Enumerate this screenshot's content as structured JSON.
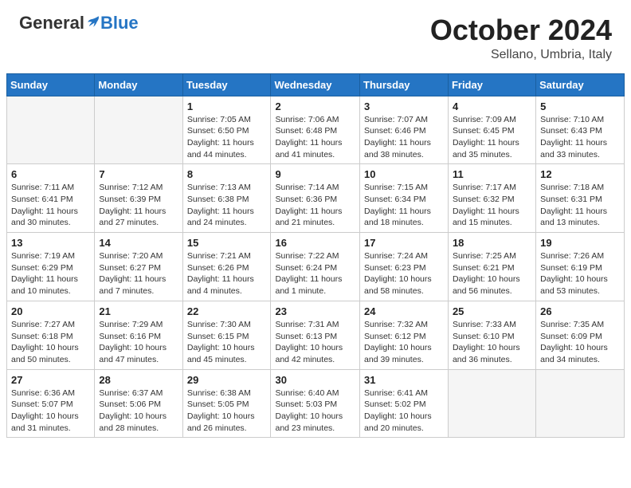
{
  "header": {
    "logo_general": "General",
    "logo_blue": "Blue",
    "month": "October 2024",
    "location": "Sellano, Umbria, Italy"
  },
  "days_of_week": [
    "Sunday",
    "Monday",
    "Tuesday",
    "Wednesday",
    "Thursday",
    "Friday",
    "Saturday"
  ],
  "weeks": [
    [
      {
        "day": "",
        "sunrise": "",
        "sunset": "",
        "daylight": ""
      },
      {
        "day": "",
        "sunrise": "",
        "sunset": "",
        "daylight": ""
      },
      {
        "day": "1",
        "sunrise": "Sunrise: 7:05 AM",
        "sunset": "Sunset: 6:50 PM",
        "daylight": "Daylight: 11 hours and 44 minutes."
      },
      {
        "day": "2",
        "sunrise": "Sunrise: 7:06 AM",
        "sunset": "Sunset: 6:48 PM",
        "daylight": "Daylight: 11 hours and 41 minutes."
      },
      {
        "day": "3",
        "sunrise": "Sunrise: 7:07 AM",
        "sunset": "Sunset: 6:46 PM",
        "daylight": "Daylight: 11 hours and 38 minutes."
      },
      {
        "day": "4",
        "sunrise": "Sunrise: 7:09 AM",
        "sunset": "Sunset: 6:45 PM",
        "daylight": "Daylight: 11 hours and 35 minutes."
      },
      {
        "day": "5",
        "sunrise": "Sunrise: 7:10 AM",
        "sunset": "Sunset: 6:43 PM",
        "daylight": "Daylight: 11 hours and 33 minutes."
      }
    ],
    [
      {
        "day": "6",
        "sunrise": "Sunrise: 7:11 AM",
        "sunset": "Sunset: 6:41 PM",
        "daylight": "Daylight: 11 hours and 30 minutes."
      },
      {
        "day": "7",
        "sunrise": "Sunrise: 7:12 AM",
        "sunset": "Sunset: 6:39 PM",
        "daylight": "Daylight: 11 hours and 27 minutes."
      },
      {
        "day": "8",
        "sunrise": "Sunrise: 7:13 AM",
        "sunset": "Sunset: 6:38 PM",
        "daylight": "Daylight: 11 hours and 24 minutes."
      },
      {
        "day": "9",
        "sunrise": "Sunrise: 7:14 AM",
        "sunset": "Sunset: 6:36 PM",
        "daylight": "Daylight: 11 hours and 21 minutes."
      },
      {
        "day": "10",
        "sunrise": "Sunrise: 7:15 AM",
        "sunset": "Sunset: 6:34 PM",
        "daylight": "Daylight: 11 hours and 18 minutes."
      },
      {
        "day": "11",
        "sunrise": "Sunrise: 7:17 AM",
        "sunset": "Sunset: 6:32 PM",
        "daylight": "Daylight: 11 hours and 15 minutes."
      },
      {
        "day": "12",
        "sunrise": "Sunrise: 7:18 AM",
        "sunset": "Sunset: 6:31 PM",
        "daylight": "Daylight: 11 hours and 13 minutes."
      }
    ],
    [
      {
        "day": "13",
        "sunrise": "Sunrise: 7:19 AM",
        "sunset": "Sunset: 6:29 PM",
        "daylight": "Daylight: 11 hours and 10 minutes."
      },
      {
        "day": "14",
        "sunrise": "Sunrise: 7:20 AM",
        "sunset": "Sunset: 6:27 PM",
        "daylight": "Daylight: 11 hours and 7 minutes."
      },
      {
        "day": "15",
        "sunrise": "Sunrise: 7:21 AM",
        "sunset": "Sunset: 6:26 PM",
        "daylight": "Daylight: 11 hours and 4 minutes."
      },
      {
        "day": "16",
        "sunrise": "Sunrise: 7:22 AM",
        "sunset": "Sunset: 6:24 PM",
        "daylight": "Daylight: 11 hours and 1 minute."
      },
      {
        "day": "17",
        "sunrise": "Sunrise: 7:24 AM",
        "sunset": "Sunset: 6:23 PM",
        "daylight": "Daylight: 10 hours and 58 minutes."
      },
      {
        "day": "18",
        "sunrise": "Sunrise: 7:25 AM",
        "sunset": "Sunset: 6:21 PM",
        "daylight": "Daylight: 10 hours and 56 minutes."
      },
      {
        "day": "19",
        "sunrise": "Sunrise: 7:26 AM",
        "sunset": "Sunset: 6:19 PM",
        "daylight": "Daylight: 10 hours and 53 minutes."
      }
    ],
    [
      {
        "day": "20",
        "sunrise": "Sunrise: 7:27 AM",
        "sunset": "Sunset: 6:18 PM",
        "daylight": "Daylight: 10 hours and 50 minutes."
      },
      {
        "day": "21",
        "sunrise": "Sunrise: 7:29 AM",
        "sunset": "Sunset: 6:16 PM",
        "daylight": "Daylight: 10 hours and 47 minutes."
      },
      {
        "day": "22",
        "sunrise": "Sunrise: 7:30 AM",
        "sunset": "Sunset: 6:15 PM",
        "daylight": "Daylight: 10 hours and 45 minutes."
      },
      {
        "day": "23",
        "sunrise": "Sunrise: 7:31 AM",
        "sunset": "Sunset: 6:13 PM",
        "daylight": "Daylight: 10 hours and 42 minutes."
      },
      {
        "day": "24",
        "sunrise": "Sunrise: 7:32 AM",
        "sunset": "Sunset: 6:12 PM",
        "daylight": "Daylight: 10 hours and 39 minutes."
      },
      {
        "day": "25",
        "sunrise": "Sunrise: 7:33 AM",
        "sunset": "Sunset: 6:10 PM",
        "daylight": "Daylight: 10 hours and 36 minutes."
      },
      {
        "day": "26",
        "sunrise": "Sunrise: 7:35 AM",
        "sunset": "Sunset: 6:09 PM",
        "daylight": "Daylight: 10 hours and 34 minutes."
      }
    ],
    [
      {
        "day": "27",
        "sunrise": "Sunrise: 6:36 AM",
        "sunset": "Sunset: 5:07 PM",
        "daylight": "Daylight: 10 hours and 31 minutes."
      },
      {
        "day": "28",
        "sunrise": "Sunrise: 6:37 AM",
        "sunset": "Sunset: 5:06 PM",
        "daylight": "Daylight: 10 hours and 28 minutes."
      },
      {
        "day": "29",
        "sunrise": "Sunrise: 6:38 AM",
        "sunset": "Sunset: 5:05 PM",
        "daylight": "Daylight: 10 hours and 26 minutes."
      },
      {
        "day": "30",
        "sunrise": "Sunrise: 6:40 AM",
        "sunset": "Sunset: 5:03 PM",
        "daylight": "Daylight: 10 hours and 23 minutes."
      },
      {
        "day": "31",
        "sunrise": "Sunrise: 6:41 AM",
        "sunset": "Sunset: 5:02 PM",
        "daylight": "Daylight: 10 hours and 20 minutes."
      },
      {
        "day": "",
        "sunrise": "",
        "sunset": "",
        "daylight": ""
      },
      {
        "day": "",
        "sunrise": "",
        "sunset": "",
        "daylight": ""
      }
    ]
  ]
}
